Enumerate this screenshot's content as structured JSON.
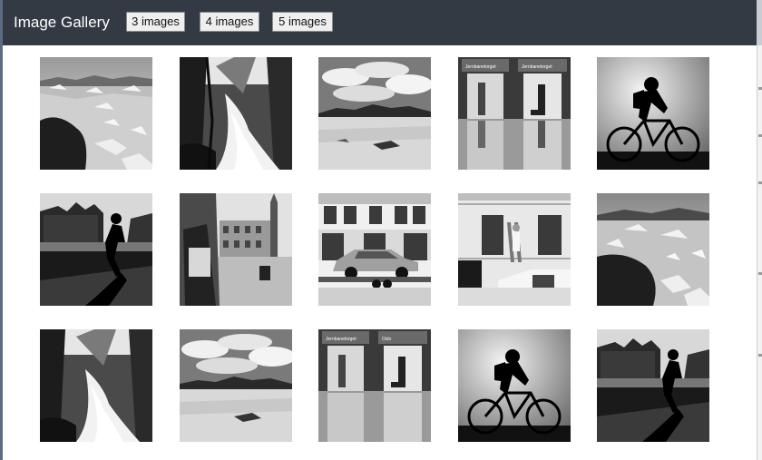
{
  "header": {
    "title": "Image Gallery",
    "buttons": [
      {
        "label": "3 images"
      },
      {
        "label": "4 images"
      },
      {
        "label": "5 images"
      }
    ]
  },
  "gallery": {
    "columns": 5,
    "rows": 3,
    "tiles": [
      {
        "subject": "frozen-lake"
      },
      {
        "subject": "forest-waterfall"
      },
      {
        "subject": "beach-clouds"
      },
      {
        "subject": "railway-station-doors"
      },
      {
        "subject": "cyclist-silhouette"
      },
      {
        "subject": "runner-by-building"
      },
      {
        "subject": "old-town-pole"
      },
      {
        "subject": "classic-car-trailer"
      },
      {
        "subject": "painter-on-ladder"
      },
      {
        "subject": "frozen-lake"
      },
      {
        "subject": "forest-waterfall"
      },
      {
        "subject": "beach-clouds"
      },
      {
        "subject": "railway-station-doors"
      },
      {
        "subject": "cyclist-silhouette"
      },
      {
        "subject": "runner-by-building"
      }
    ]
  },
  "station_sign": {
    "line1": "Jernbanetorget",
    "line2": "Oslo"
  }
}
